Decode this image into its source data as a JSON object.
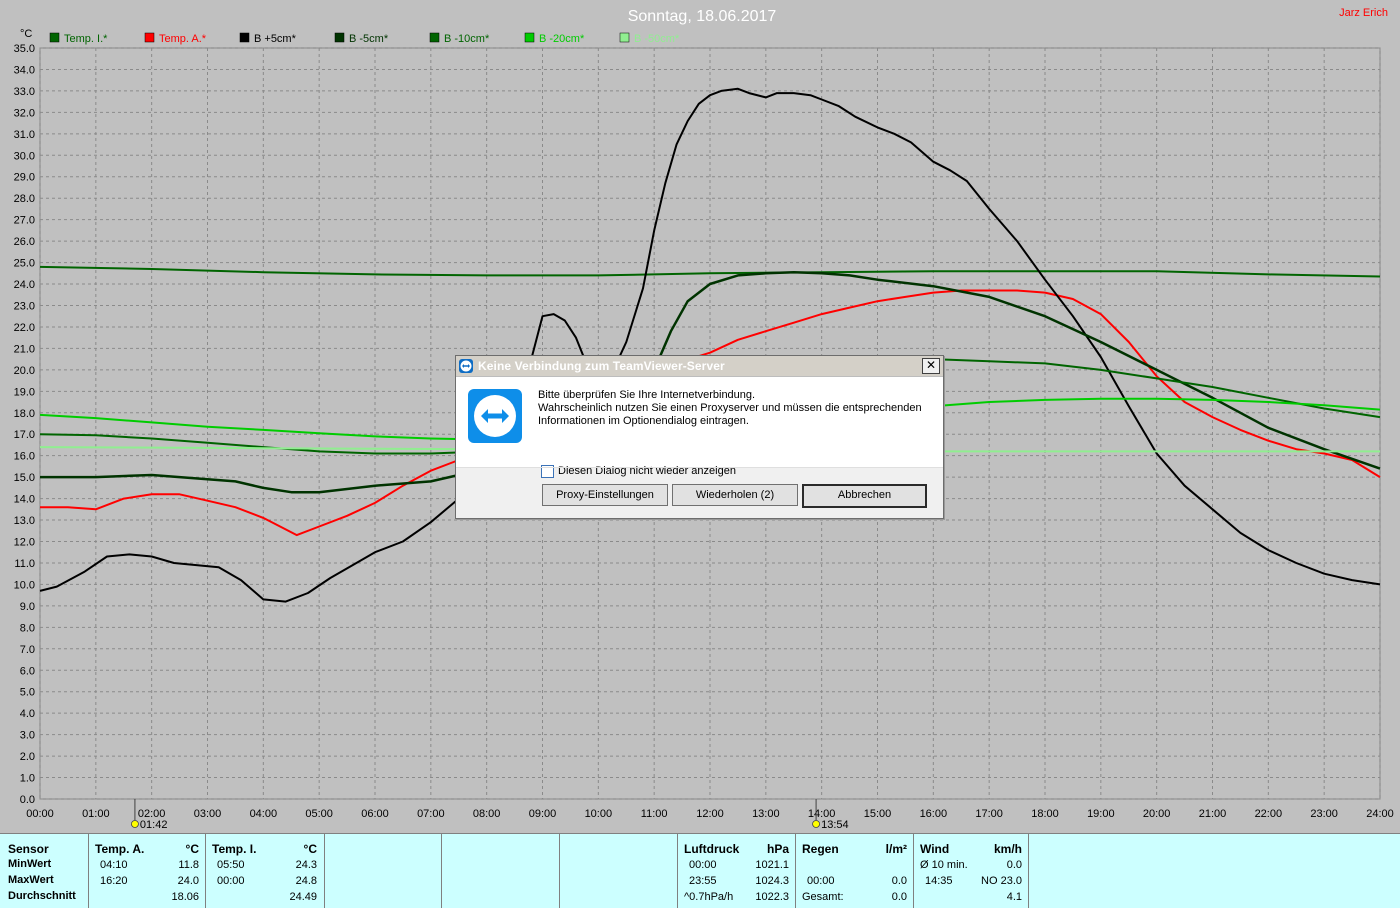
{
  "header": {
    "title": "Sonntag, 18.06.2017",
    "author": "Jarz Erich"
  },
  "chart_data": {
    "type": "line",
    "ylabel": "°C",
    "ylim": [
      0,
      35
    ],
    "xlim": [
      0,
      24
    ],
    "y_ticks": [
      "0.0",
      "1.0",
      "2.0",
      "3.0",
      "4.0",
      "5.0",
      "6.0",
      "7.0",
      "8.0",
      "9.0",
      "10.0",
      "11.0",
      "12.0",
      "13.0",
      "14.0",
      "15.0",
      "16.0",
      "17.0",
      "18.0",
      "19.0",
      "20.0",
      "21.0",
      "22.0",
      "23.0",
      "24.0",
      "25.0",
      "26.0",
      "27.0",
      "28.0",
      "29.0",
      "30.0",
      "31.0",
      "32.0",
      "33.0",
      "34.0",
      "35.0"
    ],
    "x_ticks": [
      "00:00",
      "01:00",
      "02:00",
      "03:00",
      "04:00",
      "05:00",
      "06:00",
      "07:00",
      "08:00",
      "09:00",
      "10:00",
      "11:00",
      "12:00",
      "13:00",
      "14:00",
      "15:00",
      "16:00",
      "17:00",
      "18:00",
      "19:00",
      "20:00",
      "21:00",
      "22:00",
      "23:00",
      "24:00"
    ],
    "grid": true,
    "legend_position": "top",
    "sunrise": "01:42",
    "noon": "13:54",
    "series": [
      {
        "name": "Temp. I.*",
        "color": "#006400",
        "x": [
          0,
          2,
          4,
          6,
          8,
          10,
          12,
          14,
          16,
          18,
          20,
          22,
          24
        ],
        "y": [
          24.8,
          24.7,
          24.55,
          24.45,
          24.4,
          24.4,
          24.5,
          24.55,
          24.6,
          24.6,
          24.6,
          24.45,
          24.35
        ]
      },
      {
        "name": "Temp. A.*",
        "color": "#ff0000",
        "x": [
          0,
          0.5,
          1,
          1.5,
          2,
          2.5,
          3,
          3.5,
          4,
          4.3,
          4.6,
          5,
          5.5,
          6,
          6.5,
          7,
          7.5,
          8,
          8.5,
          9,
          9.5,
          10,
          10.5,
          11,
          11.5,
          12,
          12.5,
          13,
          13.5,
          14,
          14.5,
          15,
          15.5,
          16,
          16.5,
          17,
          17.5,
          18,
          18.5,
          19,
          19.5,
          20,
          20.5,
          21,
          21.5,
          22,
          22.5,
          23,
          23.5,
          24
        ],
        "y": [
          13.6,
          13.6,
          13.5,
          14.0,
          14.2,
          14.2,
          13.9,
          13.6,
          13.1,
          12.7,
          12.3,
          12.7,
          13.2,
          13.8,
          14.6,
          15.3,
          15.8,
          16.3,
          16.9,
          17.5,
          18.2,
          18.8,
          19.4,
          19.9,
          20.4,
          20.8,
          21.4,
          21.8,
          22.2,
          22.6,
          22.9,
          23.2,
          23.4,
          23.6,
          23.7,
          23.7,
          23.7,
          23.6,
          23.3,
          22.6,
          21.3,
          19.7,
          18.5,
          17.8,
          17.2,
          16.7,
          16.3,
          16.1,
          15.8,
          15.0
        ]
      },
      {
        "name": "B +5cm*",
        "color": "#000000",
        "x": [
          0,
          0.3,
          0.8,
          1.2,
          1.6,
          2,
          2.4,
          2.8,
          3.2,
          3.6,
          4,
          4.4,
          4.8,
          5.2,
          5.6,
          6,
          6.5,
          7,
          7.5,
          8,
          8.4,
          8.8,
          9,
          9.2,
          9.4,
          9.6,
          9.8,
          10,
          10.2,
          10.5,
          10.8,
          11,
          11.2,
          11.4,
          11.6,
          11.8,
          12,
          12.2,
          12.5,
          12.7,
          13,
          13.2,
          13.5,
          13.8,
          14,
          14.3,
          14.6,
          15,
          15.3,
          15.6,
          16,
          16.3,
          16.6,
          17,
          17.5,
          18,
          18.5,
          19,
          19.5,
          20,
          20.5,
          21,
          21.5,
          22,
          22.5,
          23,
          23.5,
          24
        ],
        "y": [
          9.7,
          9.9,
          10.6,
          11.3,
          11.4,
          11.3,
          11.0,
          10.9,
          10.8,
          10.2,
          9.3,
          9.2,
          9.6,
          10.3,
          10.9,
          11.5,
          12.0,
          12.9,
          14.0,
          15.5,
          17.5,
          20.5,
          22.5,
          22.6,
          22.3,
          21.5,
          20.2,
          19.2,
          19.6,
          21.3,
          23.8,
          26.5,
          28.7,
          30.5,
          31.6,
          32.4,
          32.8,
          33.0,
          33.1,
          32.9,
          32.7,
          32.9,
          32.9,
          32.8,
          32.6,
          32.3,
          31.8,
          31.3,
          31.0,
          30.6,
          29.7,
          29.3,
          28.8,
          27.5,
          26.0,
          24.2,
          22.5,
          20.6,
          18.3,
          16.1,
          14.6,
          13.5,
          12.4,
          11.6,
          11.0,
          10.5,
          10.2,
          10.0
        ]
      },
      {
        "name": "B -5cm*",
        "color": "#003300",
        "x": [
          0,
          1,
          2,
          3,
          3.5,
          4,
          4.5,
          5,
          6,
          7,
          8,
          9,
          10,
          10.5,
          11,
          11.3,
          11.6,
          12,
          12.5,
          13,
          13.5,
          14,
          14.5,
          15,
          16,
          17,
          18,
          19,
          20,
          21,
          22,
          23,
          24
        ],
        "y": [
          15.0,
          15.0,
          15.1,
          14.9,
          14.8,
          14.5,
          14.3,
          14.3,
          14.6,
          14.8,
          15.4,
          16.2,
          17.5,
          18.8,
          20.0,
          21.8,
          23.2,
          24.0,
          24.4,
          24.5,
          24.55,
          24.5,
          24.4,
          24.2,
          23.9,
          23.4,
          22.5,
          21.3,
          20.0,
          18.7,
          17.3,
          16.3,
          15.4
        ]
      },
      {
        "name": "B -10cm*",
        "color": "#006400",
        "x": [
          0,
          1,
          2,
          3,
          4,
          5,
          6,
          7,
          8,
          9,
          10,
          11,
          12,
          13,
          14,
          15,
          16,
          17,
          18,
          19,
          20,
          21,
          22,
          23,
          24
        ],
        "y": [
          17.0,
          16.95,
          16.8,
          16.6,
          16.4,
          16.2,
          16.1,
          16.1,
          16.2,
          16.4,
          16.7,
          17.5,
          18.8,
          19.8,
          20.4,
          20.6,
          20.5,
          20.4,
          20.3,
          20.0,
          19.6,
          19.2,
          18.7,
          18.2,
          17.8
        ]
      },
      {
        "name": "B -20cm*",
        "color": "#00cc00",
        "x": [
          0,
          1,
          2,
          3,
          4,
          5,
          6,
          7,
          8,
          9,
          10,
          11,
          12,
          13,
          14,
          15,
          16,
          17,
          18,
          19,
          20,
          21,
          22,
          23,
          24
        ],
        "y": [
          17.9,
          17.75,
          17.55,
          17.35,
          17.2,
          17.05,
          16.9,
          16.8,
          16.75,
          16.8,
          16.9,
          17.2,
          17.6,
          17.9,
          18.1,
          18.2,
          18.3,
          18.5,
          18.6,
          18.65,
          18.65,
          18.6,
          18.5,
          18.35,
          18.15
        ]
      },
      {
        "name": "B -50cm*",
        "color": "#90ee90",
        "x": [
          0,
          4,
          8,
          12,
          16,
          20,
          24
        ],
        "y": [
          16.4,
          16.35,
          16.3,
          16.25,
          16.2,
          16.2,
          16.2
        ]
      }
    ]
  },
  "dialog": {
    "title": "Keine Verbindung zum TeamViewer-Server",
    "close_label": "✕",
    "message_line1": "Bitte überprüfen Sie Ihre Internetverbindung.",
    "message_line2": "Wahrscheinlich nutzen Sie einen Proxyserver und müssen die entsprechenden",
    "message_line3": "Informationen im Optionendialog eintragen.",
    "checkbox_label": "Diesen Dialog nicht wieder anzeigen",
    "btn_proxy": "Proxy-Einstellungen",
    "btn_retry": "Wiederholen (2)",
    "btn_cancel": "Abbrechen"
  },
  "stats": {
    "labels": {
      "sensor": "Sensor",
      "min": "MinWert",
      "max": "MaxWert",
      "avg": "Durchschnitt"
    },
    "temp_a": {
      "header": "Temp. A.",
      "unit": "°C",
      "min_time": "04:10",
      "min_val": "11.8",
      "max_time": "16:20",
      "max_val": "24.0",
      "avg": "18.06"
    },
    "temp_i": {
      "header": "Temp. I.",
      "unit": "°C",
      "min_time": "05:50",
      "min_val": "24.3",
      "max_time": "00:00",
      "max_val": "24.8",
      "avg": "24.49"
    },
    "pressure": {
      "header": "Luftdruck",
      "unit": "hPa",
      "min_time": "00:00",
      "min_val": "1021.1",
      "max_time": "23:55",
      "max_val": "1024.3",
      "trend": "^0.7hPa/h",
      "trend_val": "1022.3"
    },
    "rain": {
      "header": "Regen",
      "unit": "l/m²",
      "max_time": "00:00",
      "max_val": "0.0",
      "total_label": "Gesamt:",
      "total_val": "0.0"
    },
    "wind": {
      "header": "Wind",
      "unit": "km/h",
      "avg_label": "Ø 10 min.",
      "avg_val": "0.0",
      "max_time": "14:35",
      "max_val": "NO 23.0",
      "mean_val": "4.1"
    }
  }
}
